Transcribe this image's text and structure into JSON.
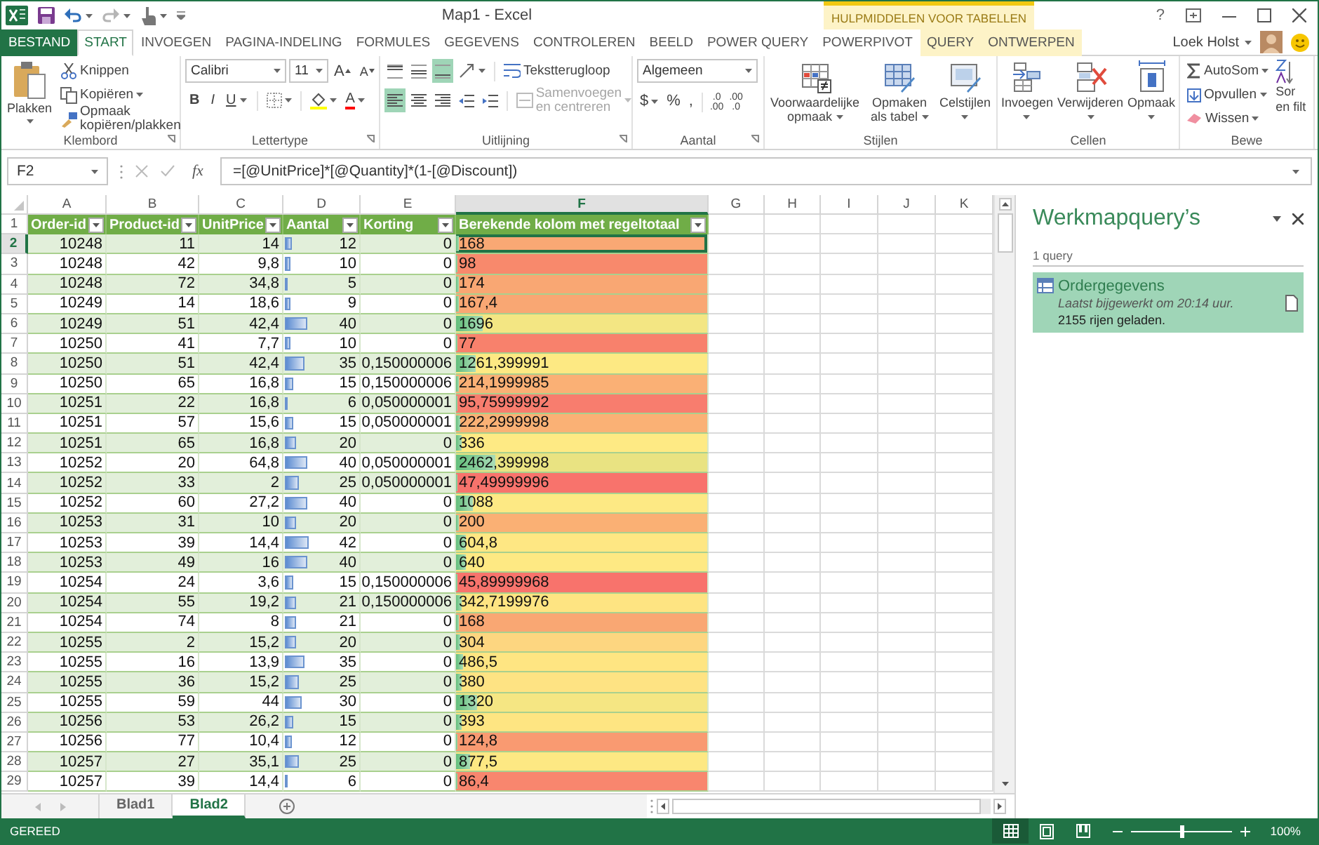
{
  "title_bar": {
    "title": "Map1 - Excel",
    "context_title": "HULPMIDDELEN VOOR TABELLEN",
    "help": "?"
  },
  "tabs": [
    {
      "label": "BESTAND",
      "kind": "file",
      "selected": false
    },
    {
      "label": "START",
      "kind": "normal",
      "selected": true
    },
    {
      "label": "INVOEGEN",
      "kind": "normal",
      "selected": false
    },
    {
      "label": "PAGINA-INDELING",
      "kind": "normal",
      "selected": false
    },
    {
      "label": "FORMULES",
      "kind": "normal",
      "selected": false
    },
    {
      "label": "GEGEVENS",
      "kind": "normal",
      "selected": false
    },
    {
      "label": "CONTROLEREN",
      "kind": "normal",
      "selected": false
    },
    {
      "label": "BEELD",
      "kind": "normal",
      "selected": false
    },
    {
      "label": "POWER QUERY",
      "kind": "normal",
      "selected": false
    },
    {
      "label": "POWERPIVOT",
      "kind": "normal",
      "selected": false
    },
    {
      "label": "QUERY",
      "kind": "contextual",
      "selected": false
    },
    {
      "label": "ONTWERPEN",
      "kind": "contextual",
      "selected": false
    }
  ],
  "user": {
    "name": "Loek Holst"
  },
  "ribbon": {
    "groups": [
      {
        "kind": "clipboard",
        "label": "Klembord",
        "launcher": true,
        "paste": "Plakken",
        "items": [
          "Knippen",
          "Kopiëren",
          "Opmaak kopiëren/plakken"
        ]
      },
      {
        "kind": "font",
        "label": "Lettertype",
        "launcher": true,
        "font": "Calibri",
        "size": "11",
        "grow": "A",
        "shrink": "A",
        "styles": [
          "B",
          "I",
          "U"
        ],
        "font_color": "A"
      },
      {
        "kind": "alignment",
        "label": "Uitlijning",
        "launcher": true,
        "vertical_align": [
          {
            "selected": false
          },
          {
            "selected": false
          },
          {
            "selected": true
          }
        ],
        "horizontal_align": [
          {
            "selected": true
          },
          {
            "selected": false
          },
          {
            "selected": false
          }
        ],
        "wrap": "Tekstterugloop",
        "merge": "Samenvoegen en centreren",
        "merge_disabled": true
      },
      {
        "kind": "number",
        "label": "Aantal",
        "launcher": true,
        "format": "Algemeen",
        "currency": "$",
        "percent": "%",
        "thousands": ",",
        "decimals": [
          {
            "top": ".0",
            "bottom": ".00"
          },
          {
            "top": ".00",
            "bottom": ".0"
          }
        ]
      },
      {
        "kind": "styles",
        "label": "Stijlen",
        "launcher": false,
        "buttons": [
          "Voorwaardelijke opmaak",
          "Opmaken als tabel",
          "Celstijlen"
        ]
      },
      {
        "kind": "cells",
        "label": "Cellen",
        "launcher": false,
        "buttons": [
          "Invoegen",
          "Verwijderen",
          "Opmaak"
        ]
      },
      {
        "kind": "editing",
        "label": "Bewe",
        "launcher": false,
        "items": [
          "AutoSom",
          "Opvullen",
          "Wissen"
        ],
        "sort": [
          "Sor",
          "en filt"
        ]
      }
    ]
  },
  "formula_bar": {
    "name_box": "F2",
    "function_label": "fx",
    "formula": "=[@UnitPrice]*[@Quantity]*(1-[@Discount])"
  },
  "grid": {
    "columns": [
      {
        "label": "A",
        "selected": false
      },
      {
        "label": "B",
        "selected": false
      },
      {
        "label": "C",
        "selected": false
      },
      {
        "label": "D",
        "selected": false
      },
      {
        "label": "E",
        "selected": false
      },
      {
        "label": "F",
        "selected": true
      },
      {
        "label": "G",
        "selected": false
      },
      {
        "label": "H",
        "selected": false
      },
      {
        "label": "I",
        "selected": false
      },
      {
        "label": "J",
        "selected": false
      },
      {
        "label": "K",
        "selected": false
      }
    ],
    "header_row": {
      "row_number": "1",
      "labels": [
        "Order-id",
        "Product-id",
        "UnitPrice",
        "Aantal",
        "Korting",
        "Berekende kolom met regeltotaal"
      ]
    },
    "rows": [
      {
        "row_number": "2",
        "selected": true,
        "cells": [
          "10248",
          "11",
          "14",
          "12",
          "0",
          "168"
        ],
        "qty_bar": {
          "level": 0.09
        },
        "total_bar": {
          "level": 0.011
        },
        "color": "#f9a874"
      },
      {
        "row_number": "3",
        "selected": false,
        "cells": [
          "10248",
          "42",
          "9,8",
          "10",
          "0",
          "98"
        ],
        "qty_bar": {
          "level": 0.07
        },
        "total_bar": {
          "level": 0.006
        },
        "color": "#f8896c"
      },
      {
        "row_number": "4",
        "selected": false,
        "cells": [
          "10248",
          "72",
          "34,8",
          "5",
          "0",
          "174"
        ],
        "qty_bar": {
          "level": 0.04
        },
        "total_bar": {
          "level": 0.011
        },
        "color": "#f9a773"
      },
      {
        "row_number": "5",
        "selected": false,
        "cells": [
          "10249",
          "14",
          "18,6",
          "9",
          "0",
          "167,4"
        ],
        "qty_bar": {
          "level": 0.07
        },
        "total_bar": {
          "level": 0.01
        },
        "color": "#f9a773"
      },
      {
        "row_number": "6",
        "selected": false,
        "cells": [
          "10249",
          "51",
          "42,4",
          "40",
          "0",
          "1696"
        ],
        "qty_bar": {
          "level": 0.29
        },
        "total_bar": {
          "level": 0.106
        },
        "color": "#f3e683"
      },
      {
        "row_number": "7",
        "selected": false,
        "cells": [
          "10250",
          "41",
          "7,7",
          "10",
          "0",
          "77"
        ],
        "qty_bar": {
          "level": 0.07
        },
        "total_bar": {
          "level": 0.005
        },
        "color": "#f8816c"
      },
      {
        "row_number": "8",
        "selected": false,
        "cells": [
          "10250",
          "51",
          "42,4",
          "35",
          "0,150000006",
          "1261,399991"
        ],
        "qty_bar": {
          "level": 0.26
        },
        "total_bar": {
          "level": 0.079
        },
        "color": "#fde983"
      },
      {
        "row_number": "9",
        "selected": false,
        "cells": [
          "10250",
          "65",
          "16,8",
          "15",
          "0,150000006",
          "214,1999985"
        ],
        "qty_bar": {
          "level": 0.11
        },
        "total_bar": {
          "level": 0.013
        },
        "color": "#fab075"
      },
      {
        "row_number": "10",
        "selected": false,
        "cells": [
          "10251",
          "22",
          "16,8",
          "6",
          "0,050000001",
          "95,75999992"
        ],
        "qty_bar": {
          "level": 0.04
        },
        "total_bar": {
          "level": 0.006
        },
        "color": "#f87d6e"
      },
      {
        "row_number": "11",
        "selected": false,
        "cells": [
          "10251",
          "57",
          "15,6",
          "15",
          "0,050000001",
          "222,2999998"
        ],
        "qty_bar": {
          "level": 0.11
        },
        "total_bar": {
          "level": 0.014
        },
        "color": "#fab175"
      },
      {
        "row_number": "12",
        "selected": false,
        "cells": [
          "10251",
          "65",
          "16,8",
          "20",
          "0",
          "336"
        ],
        "qty_bar": {
          "level": 0.15
        },
        "total_bar": {
          "level": 0.021
        },
        "color": "#feea84"
      },
      {
        "row_number": "13",
        "selected": false,
        "cells": [
          "10252",
          "20",
          "64,8",
          "40",
          "0,050000001",
          "2462,399998"
        ],
        "qty_bar": {
          "level": 0.29
        },
        "total_bar": {
          "level": 0.154
        },
        "color": "#e9e382"
      },
      {
        "row_number": "14",
        "selected": false,
        "cells": [
          "10252",
          "33",
          "2",
          "25",
          "0,050000001",
          "47,49999996"
        ],
        "qty_bar": {
          "level": 0.18
        },
        "total_bar": {
          "level": 0.003
        },
        "color": "#f8736c"
      },
      {
        "row_number": "15",
        "selected": false,
        "cells": [
          "10252",
          "60",
          "27,2",
          "40",
          "0",
          "1088"
        ],
        "qty_bar": {
          "level": 0.29
        },
        "total_bar": {
          "level": 0.068
        },
        "color": "#fde984"
      },
      {
        "row_number": "16",
        "selected": false,
        "cells": [
          "10253",
          "31",
          "10",
          "20",
          "0",
          "200"
        ],
        "qty_bar": {
          "level": 0.15
        },
        "total_bar": {
          "level": 0.0125
        },
        "color": "#fab074"
      },
      {
        "row_number": "17",
        "selected": false,
        "cells": [
          "10253",
          "39",
          "14,4",
          "42",
          "0",
          "604,8"
        ],
        "qty_bar": {
          "level": 0.31
        },
        "total_bar": {
          "level": 0.038
        },
        "color": "#fee783"
      },
      {
        "row_number": "18",
        "selected": false,
        "cells": [
          "10253",
          "49",
          "16",
          "40",
          "0",
          "640"
        ],
        "qty_bar": {
          "level": 0.29
        },
        "total_bar": {
          "level": 0.04
        },
        "color": "#fee983"
      },
      {
        "row_number": "19",
        "selected": false,
        "cells": [
          "10254",
          "24",
          "3,6",
          "15",
          "0,150000006",
          "45,89999968"
        ],
        "qty_bar": {
          "level": 0.11
        },
        "total_bar": {
          "level": 0.003
        },
        "color": "#f8736c"
      },
      {
        "row_number": "20",
        "selected": false,
        "cells": [
          "10254",
          "55",
          "19,2",
          "21",
          "0,150000006",
          "342,7199976"
        ],
        "qty_bar": {
          "level": 0.15
        },
        "total_bar": {
          "level": 0.021
        },
        "color": "#fee482"
      },
      {
        "row_number": "21",
        "selected": false,
        "cells": [
          "10254",
          "74",
          "8",
          "21",
          "0",
          "168"
        ],
        "qty_bar": {
          "level": 0.15
        },
        "total_bar": {
          "level": 0.011
        },
        "color": "#f9a773"
      },
      {
        "row_number": "22",
        "selected": false,
        "cells": [
          "10255",
          "2",
          "15,2",
          "20",
          "0",
          "304"
        ],
        "qty_bar": {
          "level": 0.15
        },
        "total_bar": {
          "level": 0.019
        },
        "color": "#fdd680"
      },
      {
        "row_number": "23",
        "selected": false,
        "cells": [
          "10255",
          "16",
          "13,9",
          "35",
          "0",
          "486,5"
        ],
        "qty_bar": {
          "level": 0.26
        },
        "total_bar": {
          "level": 0.03
        },
        "color": "#fee582"
      },
      {
        "row_number": "24",
        "selected": false,
        "cells": [
          "10255",
          "36",
          "15,2",
          "25",
          "0",
          "380"
        ],
        "qty_bar": {
          "level": 0.18
        },
        "total_bar": {
          "level": 0.024
        },
        "color": "#fee383"
      },
      {
        "row_number": "25",
        "selected": false,
        "cells": [
          "10255",
          "59",
          "44",
          "30",
          "0",
          "1320"
        ],
        "qty_bar": {
          "level": 0.22
        },
        "total_bar": {
          "level": 0.083
        },
        "color": "#f5e683"
      },
      {
        "row_number": "26",
        "selected": false,
        "cells": [
          "10256",
          "53",
          "26,2",
          "15",
          "0",
          "393"
        ],
        "qty_bar": {
          "level": 0.11
        },
        "total_bar": {
          "level": 0.025
        },
        "color": "#fee582"
      },
      {
        "row_number": "27",
        "selected": false,
        "cells": [
          "10256",
          "77",
          "10,4",
          "12",
          "0",
          "124,8"
        ],
        "qty_bar": {
          "level": 0.09
        },
        "total_bar": {
          "level": 0.008
        },
        "color": "#f99a71"
      },
      {
        "row_number": "28",
        "selected": false,
        "cells": [
          "10257",
          "27",
          "35,1",
          "25",
          "0",
          "877,5"
        ],
        "qty_bar": {
          "level": 0.18
        },
        "total_bar": {
          "level": 0.055
        },
        "color": "#fde883"
      },
      {
        "row_number": "29",
        "selected": false,
        "cells": [
          "10257",
          "39",
          "14,4",
          "6",
          "0",
          "86,4"
        ],
        "qty_bar": {
          "level": 0.04
        },
        "total_bar": {
          "level": 0.005
        },
        "color": "#f8866e"
      }
    ]
  },
  "sheets": [
    {
      "label": "Blad1",
      "selected": false
    },
    {
      "label": "Blad2",
      "selected": true
    }
  ],
  "queries_pane": {
    "title": "Werkmapquery’s",
    "count": "1 query",
    "queries": [
      {
        "name": "Ordergegevens",
        "updated": "Laatst bijgewerkt om 20:14 uur.",
        "rows": "2155 rijen geladen.",
        "selected": true
      }
    ]
  },
  "status_bar": {
    "status": "GEREED",
    "views": [
      {
        "kind": "normal",
        "selected": true
      },
      {
        "kind": "page_layout",
        "selected": false
      },
      {
        "kind": "page_break",
        "selected": false
      }
    ],
    "zoom_slider": {
      "level": 0.5
    },
    "zoom": "100%"
  }
}
